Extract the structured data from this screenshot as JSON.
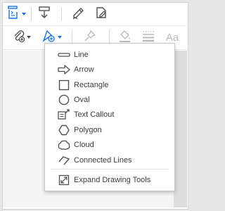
{
  "toolbar": {
    "row1": [
      {
        "icon": "page-layout-icon",
        "has_dropdown": true
      },
      {
        "icon": "stamp-icon",
        "has_dropdown": false
      },
      {
        "icon": "pen-sign-icon",
        "has_dropdown": false
      },
      {
        "icon": "edit-document-icon",
        "has_dropdown": false
      }
    ],
    "row2": [
      {
        "icon": "attach-icon",
        "has_dropdown": true
      },
      {
        "icon": "drawing-tools-icon",
        "has_dropdown": true,
        "active": true
      },
      {
        "icon": "pin-icon",
        "has_dropdown": false
      },
      {
        "icon": "fill-color-icon",
        "has_dropdown": false
      },
      {
        "icon": "line-weight-icon",
        "has_dropdown": false
      },
      {
        "icon": "text-properties-icon",
        "label": "Aa"
      }
    ],
    "accent_color": "#1473e6",
    "icon_color": "#505050",
    "disabled_icon_color": "#b9b9b9"
  },
  "menu": {
    "items": [
      {
        "label": "Line",
        "icon": "line-icon"
      },
      {
        "label": "Arrow",
        "icon": "arrow-icon"
      },
      {
        "label": "Rectangle",
        "icon": "rectangle-icon"
      },
      {
        "label": "Oval",
        "icon": "oval-icon"
      },
      {
        "label": "Text Callout",
        "icon": "text-callout-icon"
      },
      {
        "label": "Polygon",
        "icon": "polygon-icon"
      },
      {
        "label": "Cloud",
        "icon": "cloud-icon"
      },
      {
        "label": "Connected Lines",
        "icon": "connected-lines-icon"
      }
    ],
    "footer": {
      "label": "Expand Drawing Tools",
      "icon": "expand-icon"
    }
  }
}
